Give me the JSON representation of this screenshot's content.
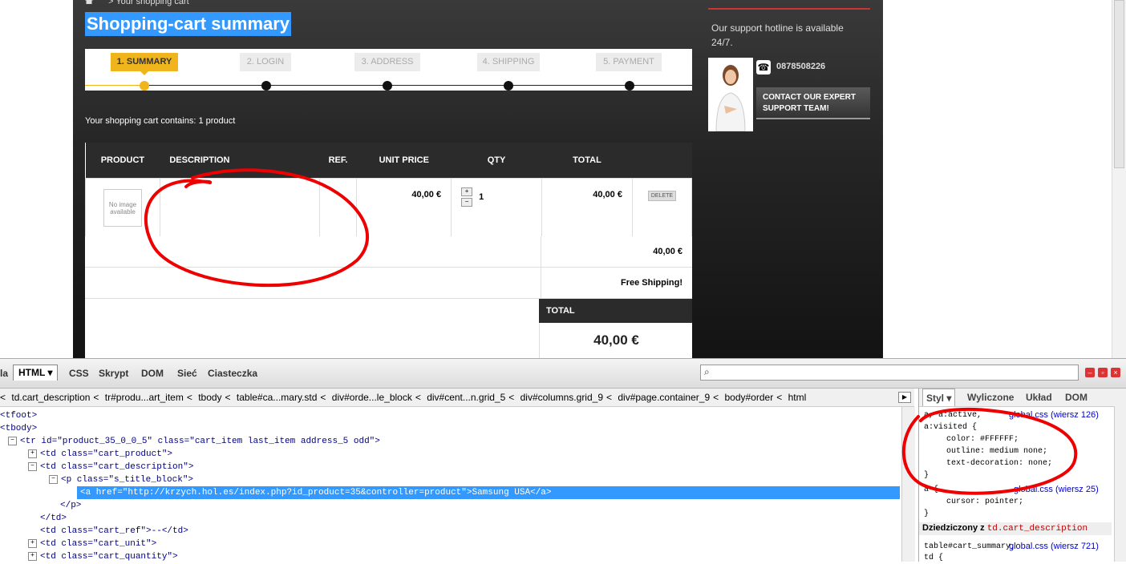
{
  "site": {
    "breadcrumb": "Your shopping cart",
    "title": "Shopping-cart summary",
    "steps": [
      "1. SUMMARY",
      "2. LOGIN",
      "3. ADDRESS",
      "4. SHIPPING",
      "5. PAYMENT"
    ],
    "cart_contains": "Your shopping cart contains: 1 product",
    "table": {
      "headers": [
        "PRODUCT",
        "DESCRIPTION",
        "REF.",
        "UNIT PRICE",
        "QTY",
        "TOTAL"
      ],
      "row": {
        "no_image": "No image available",
        "unit_price": "40,00 €",
        "qty_plus": "+",
        "qty_minus": "−",
        "qty": "1",
        "total": "40,00 €",
        "delete": "DELETE"
      },
      "subtotal": "40,00 €",
      "shipping": "Free Shipping!",
      "total_label": "TOTAL",
      "total_value": "40,00 €"
    },
    "support": {
      "hotline": "Our support hotline is available 24/7.",
      "phone": "0878508226",
      "contact_button": "CONTACT OUR EXPERT SUPPORT TEAM!"
    }
  },
  "devtools": {
    "tabs": [
      "la",
      "HTML ▾",
      "CSS",
      "Skrypt",
      "DOM",
      "Sieć",
      "Ciasteczka"
    ],
    "breadcrumbs": [
      "td.cart_description",
      "tr#produ...art_item",
      "tbody",
      "table#ca...mary.std",
      "div#orde...le_block",
      "div#cent...n.grid_5",
      "div#columns.grid_9",
      "div#page.container_9",
      "body#order",
      "html"
    ],
    "html_lines": [
      "<tfoot>",
      "<tbody>",
      "<tr id=\"product_35_0_0_5\" class=\"cart_item last_item address_5 odd\">",
      "<td class=\"cart_product\">",
      "<td class=\"cart_description\">",
      "<p class=\"s_title_block\">",
      "<a href=\"http://krzych.hol.es/index.php?id_product=35&controller=product\">Samsung USA</a>",
      "</p>",
      "</td>",
      "<td class=\"cart_ref\">--</td>",
      "<td class=\"cart_unit\">",
      "<td class=\"cart_quantity\">"
    ],
    "side_tabs": [
      "Styl ▾",
      "Wyliczone",
      "Układ",
      "DOM"
    ],
    "css_rules": {
      "rule1_sel": "a, a:active,",
      "rule1_link": "global.css (wiersz 126)",
      "rule1_sel2": "a:visited {",
      "rule1_p1": "color: #FFFFFF;",
      "rule1_p2": "outline: medium none;",
      "rule1_p3": "text-decoration: none;",
      "close": "}",
      "rule2_sel": "a {",
      "rule2_link": "global.css (wiersz 25)",
      "rule2_p1": "cursor: pointer;",
      "inherited": "Dziedziczony z",
      "inherited_from": "td.cart_description",
      "rule3_sel": "table#cart_summary,",
      "rule3_link": "global.css (wiersz 721)",
      "rule3_sel2": "td {"
    }
  }
}
